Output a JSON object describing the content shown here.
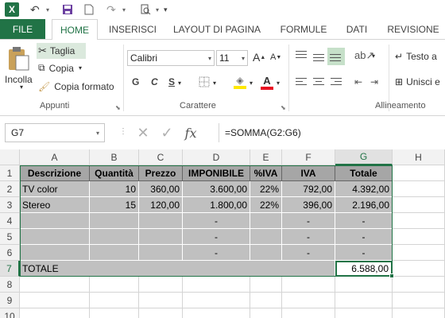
{
  "qat": {
    "logo": "X",
    "undo_icon": "undo-icon",
    "save_icon": "save-icon",
    "new_icon": "new-document-icon",
    "redo_icon": "redo-icon",
    "preview_icon": "print-preview-icon"
  },
  "tabs": {
    "file": "FILE",
    "items": [
      "HOME",
      "INSERISCI",
      "LAYOUT DI PAGINA",
      "FORMULE",
      "DATI",
      "REVISIONE"
    ]
  },
  "ribbon": {
    "paste": "Incolla",
    "cut": "Taglia",
    "copy": "Copia",
    "format_painter": "Copia formato",
    "clipboard_group": "Appunti",
    "font_name": "Calibri",
    "font_size": "11",
    "grow_font": "A",
    "shrink_font": "A",
    "bold": "G",
    "italic": "C",
    "underline": "S",
    "font_color_letter": "A",
    "font_group": "Carattere",
    "wrap_text": "Testo a",
    "merge": "Unisci e",
    "alignment_group": "Allineamento"
  },
  "formula_bar": {
    "name_box": "G7",
    "cancel_icon": "✕",
    "enter_icon": "✓",
    "fx": "fx",
    "formula": "=SOMMA(G2:G6)"
  },
  "grid": {
    "columns": [
      "A",
      "B",
      "C",
      "D",
      "E",
      "F",
      "G",
      "H"
    ],
    "rows": [
      "1",
      "2",
      "3",
      "4",
      "5",
      "6",
      "7",
      "8",
      "9",
      "10"
    ],
    "header_row": [
      "Descrizione",
      "Quantità",
      "Prezzo",
      "IMPONIBILE",
      "%IVA",
      "IVA",
      "Totale"
    ],
    "data_rows": [
      [
        "TV color",
        "10",
        "360,00",
        "3.600,00",
        "22%",
        "792,00",
        "4.392,00"
      ],
      [
        "Stereo",
        "15",
        "120,00",
        "1.800,00",
        "22%",
        "396,00",
        "2.196,00"
      ],
      [
        "",
        "",
        "",
        "-",
        "",
        "-",
        "-"
      ],
      [
        "",
        "",
        "",
        "-",
        "",
        "-",
        "-"
      ],
      [
        "",
        "",
        "",
        "-",
        "",
        "-",
        "-"
      ]
    ],
    "total_label": "TOTALE",
    "total_value": "6.588,00",
    "selected_cell": "G7"
  },
  "colors": {
    "accent": "#217346",
    "header_fill": "#a6a6a6",
    "data_fill": "#c0c0c0",
    "font_color": "#e81123",
    "highlight": "#ffe800"
  }
}
